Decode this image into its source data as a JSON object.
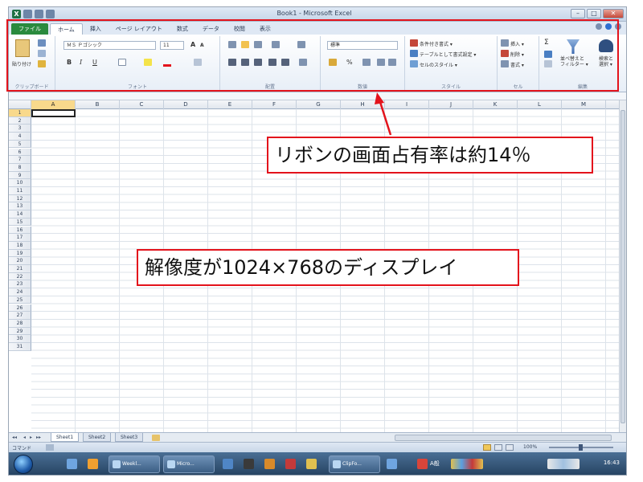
{
  "window": {
    "title": "Book1 - Microsoft Excel",
    "controls": [
      "–",
      "□",
      "✕"
    ]
  },
  "tabs": [
    "ファイル",
    "ホーム",
    "挿入",
    "ページ レイアウト",
    "数式",
    "データ",
    "校閲",
    "表示"
  ],
  "ribbon": {
    "clipboard": {
      "label": "クリップボード",
      "paste": "貼り付け"
    },
    "font": {
      "label": "フォント",
      "name": "ＭＳ Ｐゴシック",
      "size": "11",
      "bold": "B",
      "italic": "I",
      "underline": "U"
    },
    "alignment": {
      "label": "配置"
    },
    "number": {
      "label": "数値",
      "format": "標準",
      "percent": "%"
    },
    "styles": {
      "label": "スタイル",
      "items": [
        "条件付き書式 ▾",
        "テーブルとして書式設定 ▾",
        "セルのスタイル ▾"
      ]
    },
    "cells": {
      "label": "セル",
      "items": [
        "挿入 ▾",
        "削除 ▾",
        "書式 ▾"
      ]
    },
    "editing": {
      "label": "編集",
      "sort": "並べ替えと\nフィルター ▾",
      "find": "検索と\n選択 ▾"
    }
  },
  "grid": {
    "columns": [
      "A",
      "B",
      "C",
      "D",
      "E",
      "F",
      "G",
      "H",
      "I",
      "J",
      "K",
      "L",
      "M"
    ],
    "rows": [
      "1",
      "2",
      "3",
      "4",
      "5",
      "6",
      "7",
      "8",
      "9",
      "10",
      "11",
      "12",
      "13",
      "14",
      "15",
      "16",
      "17",
      "18",
      "19",
      "20",
      "21",
      "22",
      "23",
      "24",
      "25",
      "26",
      "27",
      "28",
      "29",
      "30",
      "31"
    ],
    "selected_cell": "A1"
  },
  "sheets": [
    "Sheet1",
    "Sheet2",
    "Sheet3"
  ],
  "statusbar": {
    "mode": "コマンド",
    "zoom": "100%"
  },
  "taskbar": {
    "tasks": [
      "Weekl...",
      "Micro...",
      "ClipFo..."
    ],
    "clock": "16:43",
    "ime": "A般"
  },
  "annotations": {
    "ribbon_share": "リボンの画面占有率は約14％",
    "resolution": "解像度が1024×768のディスプレイ"
  },
  "colors": {
    "annotation_border": "#e3131c",
    "file_tab": "#2a8a3e",
    "excel_green": "#1e7145"
  }
}
